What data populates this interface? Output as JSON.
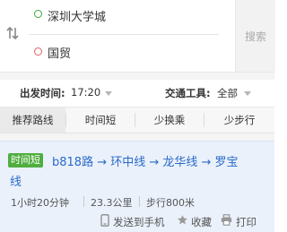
{
  "route_inputs": {
    "origin": "深圳大学城",
    "destination": "国贸",
    "search_label": "搜索"
  },
  "options": {
    "departure_label": "出发时间:",
    "departure_value": "17:20",
    "transport_label": "交通工具:",
    "transport_value": "全部"
  },
  "tabs": [
    {
      "label": "推荐路线",
      "active": true
    },
    {
      "label": "时间短",
      "active": false
    },
    {
      "label": "少换乘",
      "active": false
    },
    {
      "label": "少步行",
      "active": false
    }
  ],
  "result": {
    "badge": "时间短",
    "route_line_1": "b818路 → 环中线 → 龙华线 → 罗宝",
    "route_line_2": "线",
    "duration": "1小时20分钟",
    "distance": "23.3公里",
    "walking": "步行800米",
    "actions": {
      "send_to_phone": "发送到手机",
      "favorite": "收藏",
      "print": "打印"
    }
  },
  "colors": {
    "origin_dot": "#37a93b",
    "destination_dot": "#e06060",
    "route_link": "#2a6ac8",
    "badge_bg": "#4fae3f",
    "card_bg": "#eaf1fb"
  },
  "icons": [
    "swap-icon",
    "origin-marker-icon",
    "destination-marker-icon",
    "dropdown-caret-icon",
    "phone-icon",
    "star-icon",
    "printer-icon"
  ]
}
